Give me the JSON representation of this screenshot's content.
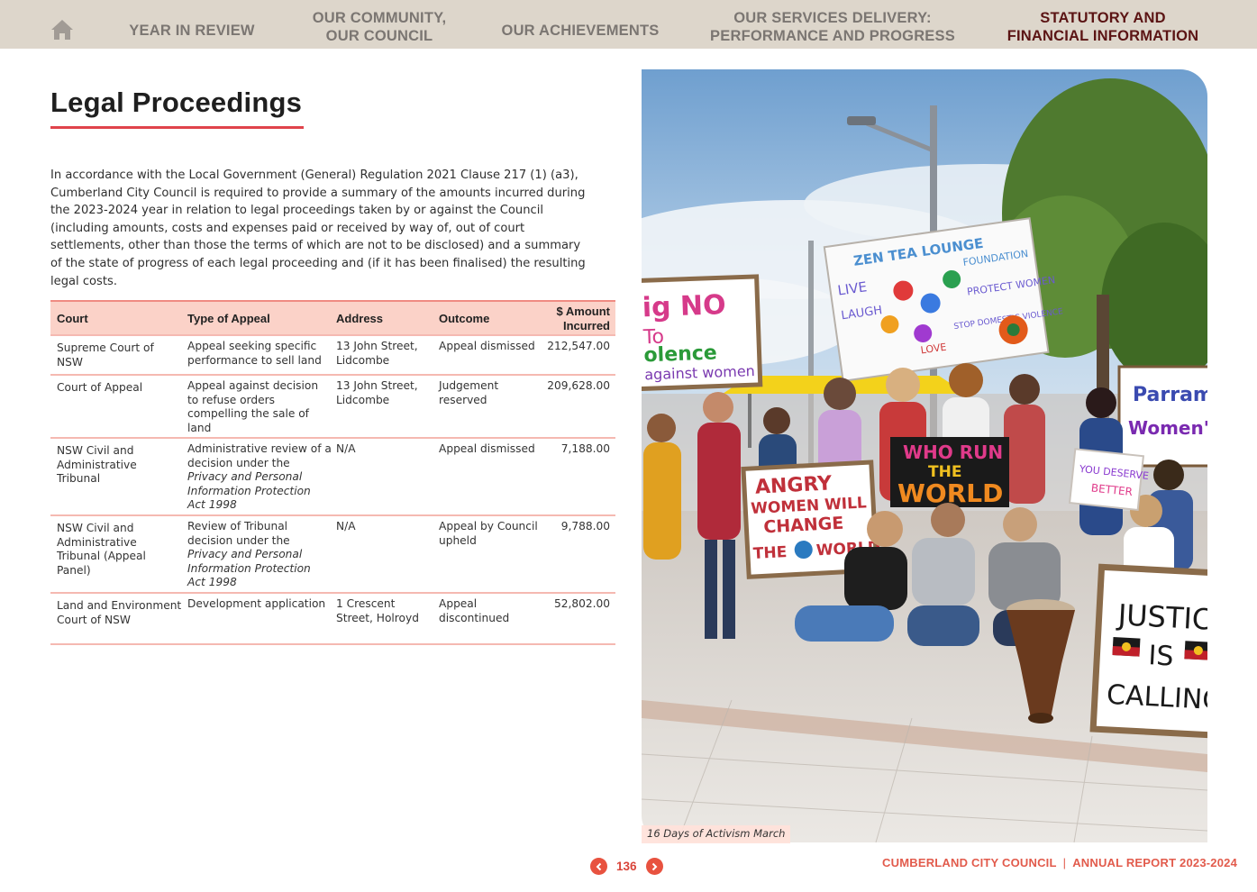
{
  "nav": {
    "home_icon": "home-icon",
    "items": [
      {
        "label": "YEAR IN REVIEW",
        "line2": ""
      },
      {
        "label": "OUR COMMUNITY,",
        "line2": "OUR COUNCIL"
      },
      {
        "label": "OUR ACHIEVEMENTS",
        "line2": ""
      },
      {
        "label": "OUR SERVICES DELIVERY:",
        "line2": "PERFORMANCE AND PROGRESS"
      },
      {
        "label": "STATUTORY AND",
        "line2": "FINANCIAL INFORMATION"
      }
    ],
    "active_index": 4,
    "colors": {
      "bar": "#ddd6cb",
      "inactive": "#7b7672",
      "active": "#5b1414"
    }
  },
  "page": {
    "title": "Legal Proceedings",
    "intro": "In accordance with the Local Government (General) Regulation 2021 Clause 217 (1) (a3), Cumberland City Council is required to provide a summary of the amounts incurred during the 2023-2024 year in relation to legal proceedings taken by or against the Council (including amounts, costs and expenses paid or received by way of, out of court settlements, other than those the terms of which are not to be disclosed) and a summary of the state of progress of each legal proceeding and (if it has been finalised) the resulting legal costs.",
    "accent_color": "#e0434b"
  },
  "table": {
    "headers": {
      "court": "Court",
      "type": "Type of Appeal",
      "address": "Address",
      "outcome": "Outcome",
      "amount_line1": "$ Amount",
      "amount_line2": "Incurred"
    },
    "rows": [
      {
        "court": "Supreme Court of NSW",
        "type": "Appeal seeking specific performance to sell land",
        "type_italic": "",
        "type_after": "",
        "address": "13 John Street, Lidcombe",
        "outcome": "Appeal dismissed",
        "amount": "212,547.00"
      },
      {
        "court": "Court of Appeal",
        "type": "Appeal against decision to refuse orders compelling the sale of land",
        "type_italic": "",
        "type_after": "",
        "address": "13 John Street, Lidcombe",
        "outcome": "Judgement reserved",
        "amount": "209,628.00"
      },
      {
        "court": "NSW Civil and Administrative Tribunal",
        "type": "Administrative review of a decision under the ",
        "type_italic": "Privacy and Personal Information Protection Act 1998",
        "type_after": "",
        "address": "N/A",
        "outcome": "Appeal dismissed",
        "amount": "7,188.00"
      },
      {
        "court": "NSW Civil and Administrative Tribunal (Appeal Panel)",
        "type": "Review of Tribunal decision under the ",
        "type_italic": "Privacy and Personal Information Protection Act 1998",
        "type_after": "",
        "address": "N/A",
        "outcome": "Appeal by Council upheld",
        "amount": "9,788.00"
      },
      {
        "court": "Land and Environment Court of NSW",
        "type": "Development application",
        "type_italic": "",
        "type_after": "",
        "address": "1 Crescent Street, Holroyd",
        "outcome": "Appeal discontinued",
        "amount": "52,802.00"
      }
    ]
  },
  "photo": {
    "caption": "16 Days of Activism March",
    "signs": {
      "left": "ig NO To olence against women",
      "banner_title": "ZEN TEA LOUNGE FOUNDATION",
      "banner_words": [
        "LIVE",
        "LAUGH",
        "PROTECT WOMEN",
        "LOVE",
        "STOP DOMESTIC VIOLENCE"
      ],
      "right_top": "Parram Women's",
      "angry": [
        "ANGRY",
        "WOMEN WILL",
        "CHANGE",
        "THE",
        "WORLD"
      ],
      "who_run": [
        "WHO RUN",
        "THE",
        "WORLD"
      ],
      "deserve": [
        "YOU DESERVE",
        "BETTER"
      ],
      "justice": [
        "JUSTICE",
        "IS",
        "CALLING"
      ]
    }
  },
  "footer": {
    "page_number": "136",
    "prev_icon": "chevron-left-icon",
    "next_icon": "chevron-right-icon",
    "org": "CUMBERLAND CITY COUNCIL",
    "separator": "|",
    "report": "ANNUAL REPORT 2023-2024"
  }
}
